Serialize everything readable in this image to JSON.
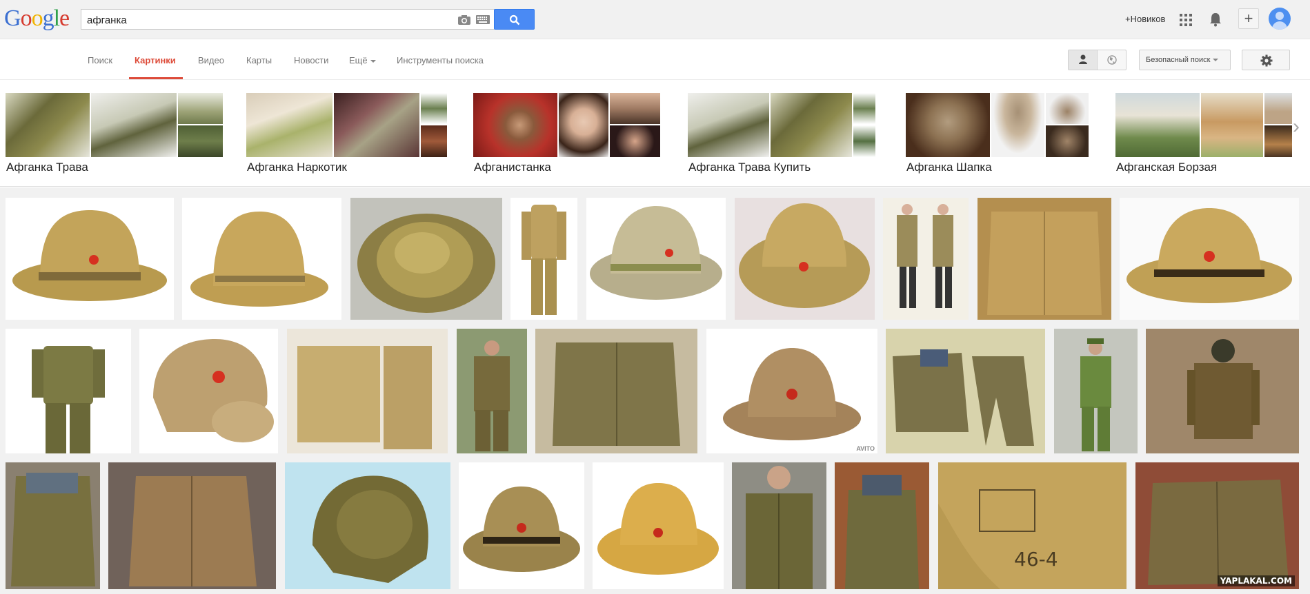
{
  "header": {
    "logo": [
      "G",
      "o",
      "o",
      "g",
      "l",
      "e"
    ],
    "query": "афганка",
    "user_name": "+Новиков",
    "plus_label": "+"
  },
  "tabs": [
    {
      "label": "Поиск",
      "active": false
    },
    {
      "label": "Картинки",
      "active": true
    },
    {
      "label": "Видео",
      "active": false
    },
    {
      "label": "Карты",
      "active": false
    },
    {
      "label": "Новости",
      "active": false
    },
    {
      "label": "Ещё",
      "active": false
    },
    {
      "label": "Инструменты поиска",
      "active": false
    }
  ],
  "tools": {
    "safe_search_label": "Безопасный поиск"
  },
  "related": [
    {
      "label": "Афганка Трава"
    },
    {
      "label": "Афганка Наркотик"
    },
    {
      "label": "Афганистанка"
    },
    {
      "label": "Афганка Трава Купить"
    },
    {
      "label": "Афганка Шапка"
    },
    {
      "label": "Афганская Борзая"
    }
  ],
  "watermarks": {
    "avito": "AVITO",
    "yaplakal": "YAPLAKAL.COM"
  },
  "colors": {
    "accent": "#dd4b39",
    "search_button": "#4a8af4",
    "khaki": "#b89b55"
  }
}
